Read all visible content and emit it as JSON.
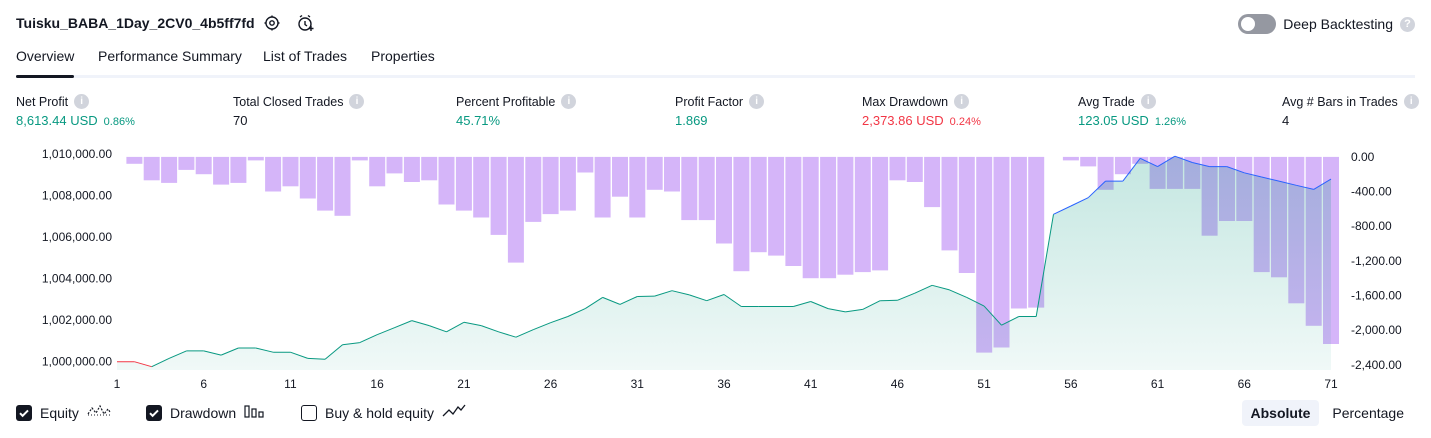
{
  "header": {
    "title": "Tuisku_BABA_1Day_2CV0_4b5ff7fd",
    "deep_backtesting_label": "Deep Backtesting",
    "deep_backtesting_on": false,
    "help_glyph": "?"
  },
  "tabs": [
    {
      "label": "Overview",
      "active": true
    },
    {
      "label": "Performance Summary",
      "active": false
    },
    {
      "label": "List of Trades",
      "active": false
    },
    {
      "label": "Properties",
      "active": false
    }
  ],
  "info_glyph": "i",
  "metrics": [
    {
      "label": "Net Profit",
      "value": "8,613.44 USD",
      "pct": "0.86%",
      "color": "#089981"
    },
    {
      "label": "Total Closed Trades",
      "value": "70",
      "pct": "",
      "color": "#131722"
    },
    {
      "label": "Percent Profitable",
      "value": "45.71%",
      "pct": "",
      "color": "#089981"
    },
    {
      "label": "Profit Factor",
      "value": "1.869",
      "pct": "",
      "color": "#089981"
    },
    {
      "label": "Max Drawdown",
      "value": "2,373.86 USD",
      "pct": "0.24%",
      "color": "#f23645"
    },
    {
      "label": "Avg Trade",
      "value": "123.05 USD",
      "pct": "1.26%",
      "color": "#089981"
    },
    {
      "label": "Avg # Bars in Trades",
      "value": "4",
      "pct": "",
      "color": "#131722"
    }
  ],
  "chart_data": {
    "type": "line+bar",
    "x_ticks": [
      "1",
      "6",
      "11",
      "16",
      "21",
      "26",
      "31",
      "36",
      "41",
      "46",
      "51",
      "56",
      "61",
      "66",
      "71"
    ],
    "y_left_ticks": [
      "1,010,000.00",
      "1,008,000.00",
      "1,006,000.00",
      "1,004,000.00",
      "1,002,000.00",
      "1,000,000.00"
    ],
    "y_left_range": [
      999600,
      1010200
    ],
    "y_right_ticks": [
      "0.00",
      "-400.00",
      "-800.00",
      "-1,200.00",
      "-1,600.00",
      "-2,000.00",
      "-2,400.00"
    ],
    "y_right_range": [
      -2460,
      80
    ],
    "series": [
      {
        "name": "Equity",
        "color_up": "#089981",
        "color_down": "#f23645",
        "color_after": "#2962ff",
        "x": [
          1,
          2,
          3,
          4,
          5,
          6,
          7,
          8,
          9,
          10,
          11,
          12,
          13,
          14,
          15,
          16,
          17,
          18,
          19,
          20,
          21,
          22,
          23,
          24,
          25,
          26,
          27,
          28,
          29,
          30,
          31,
          32,
          33,
          34,
          35,
          36,
          37,
          38,
          39,
          40,
          41,
          42,
          43,
          44,
          45,
          46,
          47,
          48,
          49,
          50,
          51,
          52,
          53,
          54,
          55,
          56,
          57,
          58,
          59,
          60,
          61,
          62,
          63,
          64,
          65,
          66,
          67,
          68,
          69,
          70,
          71
        ],
        "y": [
          1000000,
          1000000,
          999760,
          1000160,
          1000520,
          1000520,
          1000320,
          1000660,
          1000660,
          1000460,
          1000460,
          1000160,
          1000120,
          1000820,
          1000920,
          1001300,
          1001640,
          1001980,
          1001740,
          1001440,
          1001900,
          1001740,
          1001440,
          1001180,
          1001540,
          1001880,
          1002180,
          1002560,
          1003100,
          1002760,
          1003140,
          1003160,
          1003420,
          1003220,
          1002940,
          1003240,
          1002660,
          1002660,
          1002660,
          1002660,
          1002900,
          1002560,
          1002400,
          1002520,
          1002940,
          1002960,
          1003300,
          1003680,
          1003460,
          1003100,
          1002680,
          1001760,
          1002180,
          1002180,
          1007100,
          1007500,
          1007900,
          1008700,
          1008700,
          1009800,
          1009400,
          1009900,
          1009600,
          1009400,
          1009400,
          1009100,
          1008900,
          1008700,
          1008500,
          1008300,
          1008800
        ]
      },
      {
        "name": "Drawdown",
        "color": "#cea8f8",
        "x": [
          1,
          2,
          3,
          4,
          5,
          6,
          7,
          8,
          9,
          10,
          11,
          12,
          13,
          14,
          15,
          16,
          17,
          18,
          19,
          20,
          21,
          22,
          23,
          24,
          25,
          26,
          27,
          28,
          29,
          30,
          31,
          32,
          33,
          34,
          35,
          36,
          37,
          38,
          39,
          40,
          41,
          42,
          43,
          44,
          45,
          46,
          47,
          48,
          49,
          50,
          51,
          52,
          53,
          54,
          55,
          56,
          57,
          58,
          59,
          60,
          61,
          62,
          63,
          64,
          65,
          66,
          67,
          68,
          69,
          70,
          71
        ],
        "y": [
          0,
          -80,
          -270,
          -300,
          -150,
          -200,
          -320,
          -300,
          -40,
          -400,
          -340,
          -480,
          -620,
          -680,
          -40,
          -340,
          -190,
          -290,
          -270,
          -550,
          -620,
          -700,
          -900,
          -1220,
          -750,
          -660,
          -620,
          -180,
          -700,
          -460,
          -700,
          -380,
          -400,
          -730,
          -730,
          -1000,
          -1320,
          -1100,
          -1140,
          -1260,
          -1400,
          -1400,
          -1360,
          -1330,
          -1310,
          -270,
          -290,
          -580,
          -1080,
          -1340,
          -2260,
          -2200,
          -1750,
          -1740,
          0,
          -40,
          -110,
          -380,
          -200,
          -80,
          -370,
          -370,
          -370,
          -910,
          -740,
          -740,
          -1330,
          -1390,
          -1690,
          -1950,
          -2160
        ]
      }
    ],
    "legend": [
      {
        "label": "Equity",
        "checked": true,
        "icon": "equity-wave-icon"
      },
      {
        "label": "Drawdown",
        "checked": true,
        "icon": "drawdown-bars-icon"
      },
      {
        "label": "Buy & hold equity",
        "checked": false,
        "icon": "buyhold-line-icon"
      }
    ]
  },
  "modes": [
    {
      "label": "Absolute",
      "active": true
    },
    {
      "label": "Percentage",
      "active": false
    }
  ]
}
